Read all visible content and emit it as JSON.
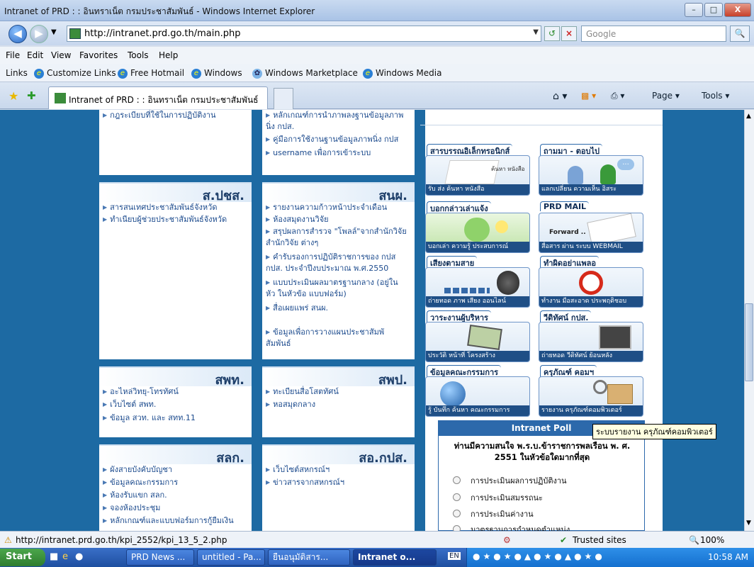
{
  "window": {
    "title": "Intranet of PRD : : อินทราเน็ต กรมประชาสัมพันธ์ - Windows Internet Explorer",
    "min": "–",
    "max": "□",
    "close": "X"
  },
  "address": {
    "url": "http://intranet.prd.go.th/main.php",
    "search_placeholder": "Google"
  },
  "menu": [
    "File",
    "Edit",
    "View",
    "Favorites",
    "Tools",
    "Help"
  ],
  "links": {
    "label": "Links",
    "items": [
      "Customize Links",
      "Free Hotmail",
      "Windows",
      "Windows Marketplace",
      "Windows Media"
    ]
  },
  "tab": {
    "title": "Intranet of PRD : : อินทราเน็ต กรมประชาสัมพันธ์"
  },
  "cmd": {
    "page": "Page ▾",
    "tools": "Tools ▾"
  },
  "sections": {
    "top_left": [
      "กฎระเบียบที่ใช้ในการปฏิบัติงาน"
    ],
    "top_mid": [
      "หลักเกณฑ์การนำภาพลงฐานข้อมูลภาพนิ่ง กปส.",
      "คู่มือการใช้งานฐานข้อมูลภาพนิ่ง กปส",
      "username เพื่อการเข้าระบบ"
    ],
    "spchs": {
      "title": "ส.ปชส.",
      "items": [
        "สารสนเทศประชาสัมพันธ์จังหวัด",
        "ทำเนียบผู้ช่วยประชาสัมพันธ์จังหวัด"
      ]
    },
    "snp": {
      "title": "สนผ.",
      "items": [
        "รายงานความก้าวหน้าประจำเดือน",
        "ห้องสมุดงานวิจัย",
        "สรุปผลการสำรวจ \"โพลล์\"จากสำนักวิจัย สำนักวิจัย ต่างๆ",
        "คำรับรองการปฏิบัติราชการของ กปส กปส. ประจำปีงบประมาณ พ.ศ.2550",
        "แบบประเมินผลมาตรฐานกลาง (อยู่ในหัว ในหัวข้อ แบบฟอร์ม)",
        "สื่อเผยแพร่ สนผ.",
        "ข้อมูลเพื่อการวางแผนประชาสัมพั สัมพันธ์"
      ]
    },
    "sawt": {
      "title": "สพท.",
      "items": [
        "อะไหล่วิทยุ-โทรทัศน์",
        "เว็บไซต์ สพท.",
        "ข้อมูล สวท. และ สทท.11"
      ]
    },
    "swp": {
      "title": "สพป.",
      "items": [
        "ทะเบียนสื่อโสตทัศน์",
        "หอสมุดกลาง"
      ]
    },
    "slk": {
      "title": "สลก.",
      "items": [
        "ผังสายบังคับบัญชา",
        "ข้อมูลคณะกรรมการ",
        "ห้องรับแขก สลก.",
        "จองห้องประชุม",
        "หลักเกณฑ์และแบบฟอร์มการกู้ยืมเงิน"
      ]
    },
    "sokps": {
      "title": "สอ.กปส.",
      "items": [
        "เว็บไซต์สหกรณ์ฯ",
        "ข่าวสารจากสหกรณ์ฯ"
      ]
    }
  },
  "tiles": [
    {
      "band": "สารบรรณอิเล็กทรอนิกส์",
      "cap": "รับ ส่ง ค้นหา หนังสือ",
      "icon": "document-icon",
      "inner": "ค้นหา หนังสือ"
    },
    {
      "band": "ถามมา - ตอบไป",
      "cap": "แลกเปลี่ยน ความเห็น อิสระ",
      "icon": "users-chat-icon"
    },
    {
      "band": "บอกกล่าวเล่าแจ้ง",
      "cap": "บอกเล่า ความรู้ ประสบการณ์",
      "icon": "user-idea-icon"
    },
    {
      "band": "PRD MAIL",
      "cap": "สื่อสาร ผ่าน ระบบ WEBMAIL",
      "icon": "mail-icon",
      "inner": "Forward .."
    },
    {
      "band": "เสียงตามสาย",
      "cap": "ถ่ายทอด ภาพ เสียง ออนไลน์",
      "icon": "speaker-icon"
    },
    {
      "band": "ทำผิดอย่าแพลอ",
      "cap": "ทำงาน มือสะอาด ประพฤติชอบ",
      "icon": "no-bribe-icon"
    },
    {
      "band": "วาระงานผู้บริหาร",
      "cap": "ประวัติ หน้าที่ โครงสร้าง",
      "icon": "presentation-icon"
    },
    {
      "band": "วีดิทัศน์ กปส.",
      "cap": "ถ่ายทอด วีดิทัศน์ ย้อนหลัง",
      "icon": "video-icon"
    },
    {
      "band": "ข้อมูลคณะกรรมการ",
      "cap": "รู้ บันทึก ค้นหา คณะกรรมการ",
      "icon": "globe-icon"
    },
    {
      "band": "ครุภัณฑ์ คอมฯ",
      "cap": "รายงาน ครุภัณฑ์คอมพิวเตอร์",
      "icon": "box-search-icon"
    }
  ],
  "poll": {
    "heading": "Intranet Poll",
    "question": "ท่านมีความสนใจ พ.ร.บ.ข้าราชการพลเรือน พ. ศ. 2551 ในหัวข้อใดมากที่สุด",
    "options": [
      "การประเมินผลการปฏิบัติงาน",
      "การประเมินสมรรถนะ",
      "การประเมินค่างาน",
      "มาตรฐานการกำหนดตำแหน่ง"
    ]
  },
  "tooltip": "ระบบรายงาน ครุภัณฑ์คอมพิวเตอร์",
  "status": {
    "url": "http://intranet.prd.go.th/kpi_2552/kpi_13_5_2.php",
    "zone": "Trusted sites",
    "zoom": "100%"
  },
  "taskbar": {
    "start": "Start",
    "tasks": [
      "PRD News ...",
      "untitled - Pa...",
      "ยืนอนุมัติสาร...",
      "Intranet o..."
    ],
    "lang": "EN",
    "clock": "10:58 AM"
  }
}
